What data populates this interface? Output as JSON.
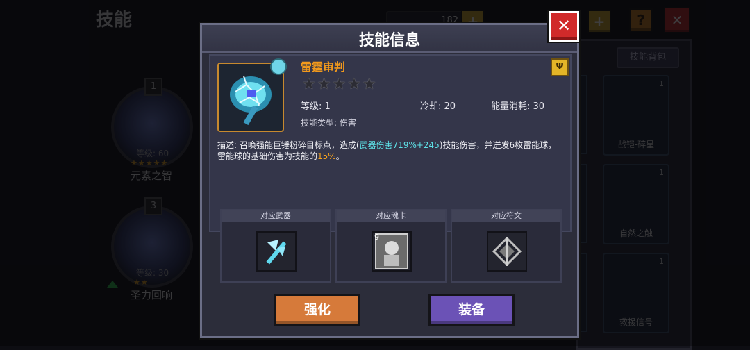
{
  "background": {
    "title": "技能",
    "resource_value": "182",
    "bag_button": "技能背包",
    "left_skills": [
      {
        "rank": "1",
        "level": "等级: 60",
        "stars": "★★★★★",
        "name": "元素之智"
      },
      {
        "rank": "3",
        "level": "等级: 30",
        "stars": "★★",
        "name": "圣力回响"
      }
    ],
    "right_cards": [
      {
        "rank": "1",
        "name": "战铠-碎星"
      },
      {
        "rank": "1",
        "name": "自然之触"
      },
      {
        "rank": "1",
        "name": "救援信号"
      }
    ]
  },
  "modal": {
    "title": "技能信息",
    "close_label": "✕",
    "skill": {
      "name": "雷霆审判",
      "stars_total": 5,
      "stars_filled": 0,
      "stars_text": "★★★★★",
      "rune_icon": "Ψ",
      "level_label": "等级: 1",
      "cooldown_label": "冷却: 20",
      "energy_label": "能量消耗: 30",
      "type_label": "技能类型: 伤害",
      "desc_prefix": "描述: 召唤强能巨锤粉碎目标点，造成(",
      "desc_hl1": "武器伤害719%+245",
      "desc_mid": ")技能伤害，并迸发6枚雷能球，雷能球的基础伤害为技能的",
      "desc_hl2": "15%",
      "desc_suffix": "。"
    },
    "slots": [
      {
        "label": "对应武器",
        "icon": "weapon-axe-icon"
      },
      {
        "label": "对应魂卡",
        "icon": "soul-card-icon",
        "card_level": "9"
      },
      {
        "label": "对应符文",
        "icon": "rune-icon"
      }
    ],
    "buttons": {
      "upgrade": "强化",
      "equip": "装备"
    }
  },
  "colors": {
    "accent_orange": "#f39a1c",
    "highlight_cyan": "#5ee0e6",
    "close_red": "#d12a2a",
    "upgrade_button": "#d67a3a",
    "equip_button": "#6b52b6"
  }
}
